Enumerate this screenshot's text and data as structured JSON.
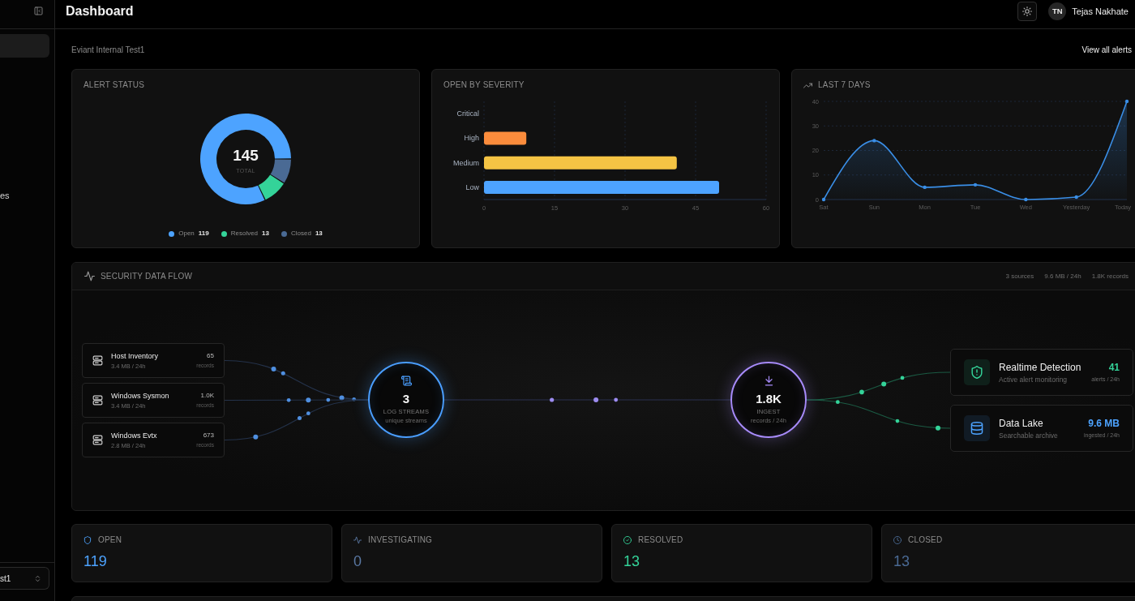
{
  "sidebar": {
    "items": [
      {
        "selected": true
      },
      {
        "label": "es",
        "selected": false
      }
    ],
    "workspace": {
      "value": "st1"
    }
  },
  "header": {
    "title": "Dashboard",
    "user": {
      "initials": "TN",
      "name": "Tejas Nakhate"
    }
  },
  "toolbar": {
    "organization": "Eviant Internal Test1",
    "action": "View all alerts"
  },
  "alert_status": {
    "title": "ALERT STATUS",
    "total": "145",
    "total_label": "TOTAL",
    "chart_data": {
      "type": "donut",
      "categories": [
        "Open",
        "Resolved",
        "Closed"
      ],
      "values": [
        119,
        13,
        13
      ],
      "colors": [
        "#4da3ff",
        "#34d399",
        "#4a6a94"
      ],
      "data_labels": true,
      "legend": "bottom"
    }
  },
  "severity": {
    "title": "OPEN BY SEVERITY",
    "chart_data": {
      "type": "bar",
      "orientation": "horizontal",
      "categories": [
        "Critical",
        "High",
        "Medium",
        "Low"
      ],
      "values": [
        0,
        9,
        41,
        50
      ],
      "colors": [
        null,
        "#fb8c3c",
        "#f5c444",
        "#4da3ff"
      ],
      "xlim": [
        0,
        60
      ],
      "xticks": [
        0,
        15,
        30,
        45,
        60
      ],
      "grid": true
    }
  },
  "trend": {
    "title": "LAST 7 DAYS",
    "chart_data": {
      "type": "area",
      "categories": [
        "Sat",
        "Sun",
        "Mon",
        "Tue",
        "Wed",
        "Yesterday",
        "Today"
      ],
      "series": [
        {
          "color": "#3a8ee6",
          "values": [
            0,
            24,
            5,
            6,
            0,
            1,
            40
          ]
        }
      ],
      "ylim": [
        0,
        40
      ],
      "yticks": [
        0,
        10,
        20,
        30,
        40
      ],
      "grid": true
    }
  },
  "data_flow": {
    "title": "SECURITY DATA FLOW",
    "summary": [
      "3 sources",
      "9.6 MB / 24h",
      "1.8K records"
    ],
    "sources": [
      {
        "name": "Host Inventory",
        "volume": "3.4 MB / 24h",
        "count": "65",
        "unit": "records"
      },
      {
        "name": "Windows Sysmon",
        "volume": "3.4 MB / 24h",
        "count": "1.0K",
        "unit": "records"
      },
      {
        "name": "Windows Evtx",
        "volume": "2.8 MB / 24h",
        "count": "673",
        "unit": "records"
      }
    ],
    "hubs": [
      {
        "kind": "streams",
        "value": "3",
        "label": "LOG STREAMS",
        "caption": "unique streams",
        "color": "#4a9eff"
      },
      {
        "kind": "ingest",
        "value": "1.8K",
        "label": "INGEST",
        "caption": "records / 24h",
        "color": "#a78bfa"
      }
    ],
    "destinations": [
      {
        "kind": "detection",
        "name": "Realtime Detection",
        "description": "Active alert monitoring",
        "value": "41",
        "unit": "alerts / 24h",
        "color": "#34d399"
      },
      {
        "kind": "lake",
        "name": "Data Lake",
        "description": "Searchable archive",
        "value": "9.6 MB",
        "unit": "ingested / 24h",
        "color": "#4da3ff"
      }
    ]
  },
  "stats": [
    {
      "kind": "open",
      "label": "OPEN",
      "value": "119",
      "color": "#4da3ff"
    },
    {
      "kind": "investigating",
      "label": "INVESTIGATING",
      "value": "0",
      "color": "#5a78a3"
    },
    {
      "kind": "resolved",
      "label": "RESOLVED",
      "value": "13",
      "color": "#34d399"
    },
    {
      "kind": "closed",
      "label": "CLOSED",
      "value": "13",
      "color": "#4a6a94"
    }
  ]
}
